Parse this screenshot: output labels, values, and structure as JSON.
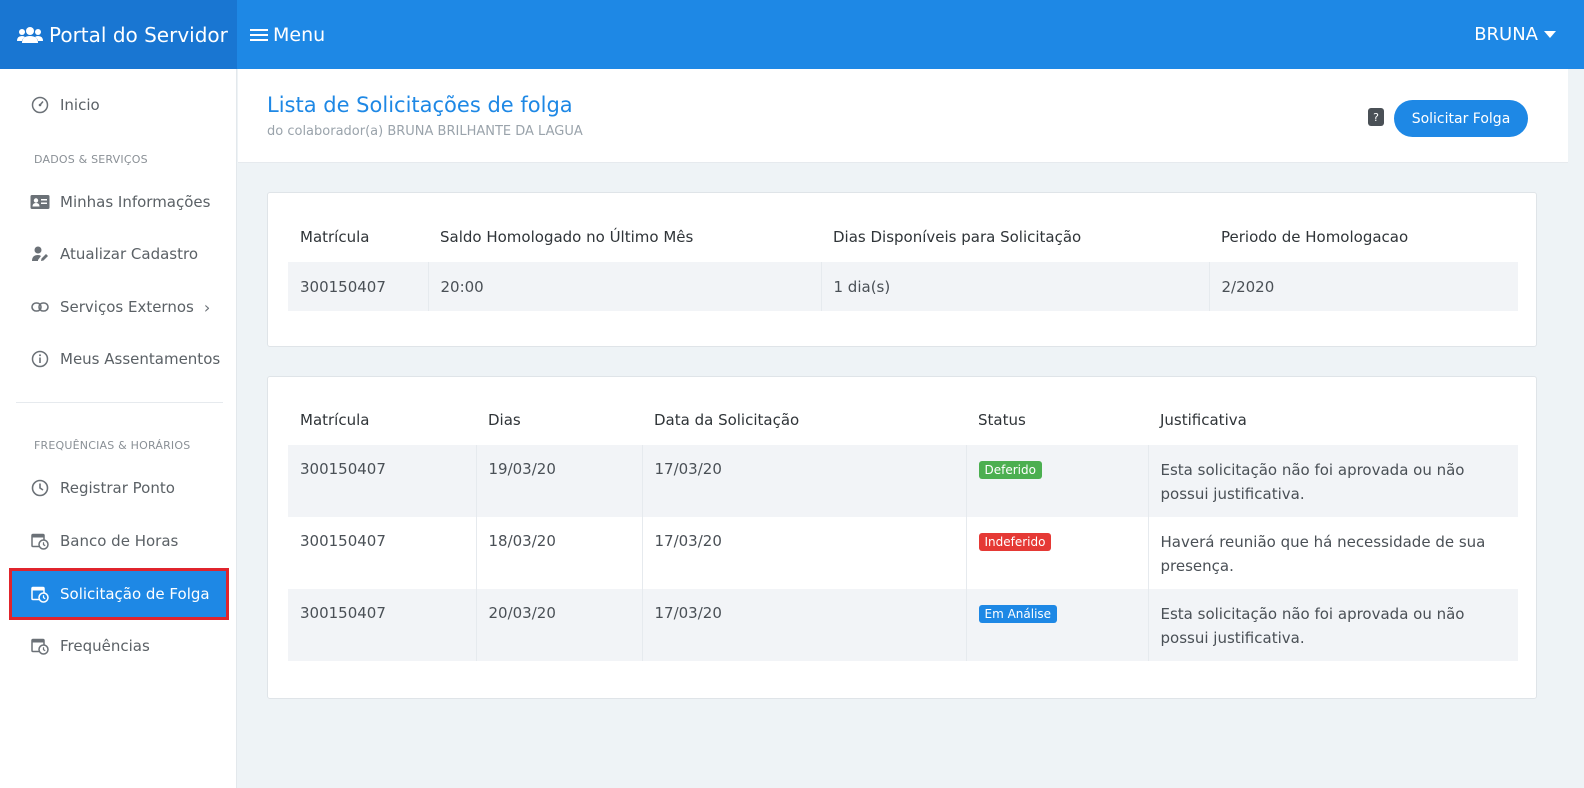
{
  "topbar": {
    "brand": "Portal do Servidor",
    "menu_label": "Menu",
    "user": "BRUNA"
  },
  "sidebar": {
    "items": [
      {
        "label": "Inicio",
        "icon": "dashboard-icon"
      },
      {
        "label": "Minhas Informações",
        "icon": "id-card-icon"
      },
      {
        "label": "Atualizar Cadastro",
        "icon": "user-edit-icon"
      },
      {
        "label": "Serviços Externos",
        "icon": "link-icon"
      },
      {
        "label": "Meus Assentamentos",
        "icon": "info-icon"
      },
      {
        "label": "Registrar Ponto",
        "icon": "clock-icon"
      },
      {
        "label": "Banco de Horas",
        "icon": "calendar-clock-icon"
      },
      {
        "label": "Solicitação de Folga",
        "icon": "calendar-clock-icon"
      },
      {
        "label": "Frequências",
        "icon": "calendar-clock-icon"
      }
    ],
    "sections": [
      "DADOS & SERVIÇOS",
      "FREQUÊNCIAS & HORÁRIOS"
    ]
  },
  "header": {
    "title": "Lista de Solicitações de folga",
    "subtitle": "do colaborador(a) BRUNA BRILHANTE DA LAGUA",
    "help": "?",
    "button": "Solicitar Folga"
  },
  "summary": {
    "headers": [
      "Matrícula",
      "Saldo Homologado no Último Mês",
      "Dias Disponíveis para Solicitação",
      "Periodo de Homologacao"
    ],
    "row": [
      "300150407",
      "20:00",
      "1 dia(s)",
      "2/2020"
    ]
  },
  "requests": {
    "headers": [
      "Matrícula",
      "Dias",
      "Data da Solicitação",
      "Status",
      "Justificativa"
    ],
    "rows": [
      {
        "matricula": "300150407",
        "dias": "19/03/20",
        "data": "17/03/20",
        "status": "Deferido",
        "status_color": "#4caf50",
        "justificativa": "Esta solicitação não foi aprovada ou não possui justificativa."
      },
      {
        "matricula": "300150407",
        "dias": "18/03/20",
        "data": "17/03/20",
        "status": "Indeferido",
        "status_color": "#e53935",
        "justificativa": "Haverá reunião que há necessidade de sua presença."
      },
      {
        "matricula": "300150407",
        "dias": "20/03/20",
        "data": "17/03/20",
        "status": "Em Análise",
        "status_color": "#1e88e5",
        "justificativa": "Esta solicitação não foi aprovada ou não possui justificativa."
      }
    ]
  },
  "colors": {
    "primary": "#1e88e5",
    "brand_dark": "#1976d2",
    "active_outline": "#e0242c"
  }
}
